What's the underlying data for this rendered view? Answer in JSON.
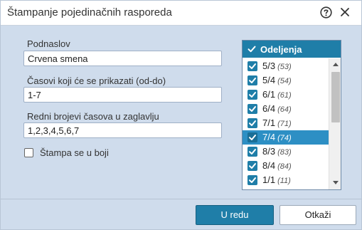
{
  "dialog": {
    "title": "Štampanje pojedinačnih rasporeda"
  },
  "form": {
    "subtitle_label": "Podnaslov",
    "subtitle_value": "Crvena smena",
    "hours_label": "Časovi koji će se prikazati (od-do)",
    "hours_value": "1-7",
    "header_numbers_label": "Redni brojevi časova u zaglavlju",
    "header_numbers_value": "1,2,3,4,5,6,7",
    "color_print_label": "Štampa se u boji",
    "color_print_checked": false
  },
  "list": {
    "header": "Odeljenja",
    "items": [
      {
        "label": "5/3",
        "count": "(53)",
        "checked": true,
        "selected": false
      },
      {
        "label": "5/4",
        "count": "(54)",
        "checked": true,
        "selected": false
      },
      {
        "label": "6/1",
        "count": "(61)",
        "checked": true,
        "selected": false
      },
      {
        "label": "6/4",
        "count": "(64)",
        "checked": true,
        "selected": false
      },
      {
        "label": "7/1",
        "count": "(71)",
        "checked": true,
        "selected": false
      },
      {
        "label": "7/4",
        "count": "(74)",
        "checked": true,
        "selected": true
      },
      {
        "label": "8/3",
        "count": "(83)",
        "checked": true,
        "selected": false
      },
      {
        "label": "8/4",
        "count": "(84)",
        "checked": true,
        "selected": false
      },
      {
        "label": "1/1",
        "count": "(11)",
        "checked": true,
        "selected": false
      }
    ]
  },
  "buttons": {
    "ok_label": "U redu",
    "cancel_label": "Otkaži"
  },
  "colors": {
    "accent": "#1f7ea8",
    "selection": "#2d8fc4",
    "background": "#cfdcec"
  },
  "icons": {
    "help": "help-circle-icon",
    "close": "close-icon",
    "checkbox": "checkbox-checked-icon"
  }
}
